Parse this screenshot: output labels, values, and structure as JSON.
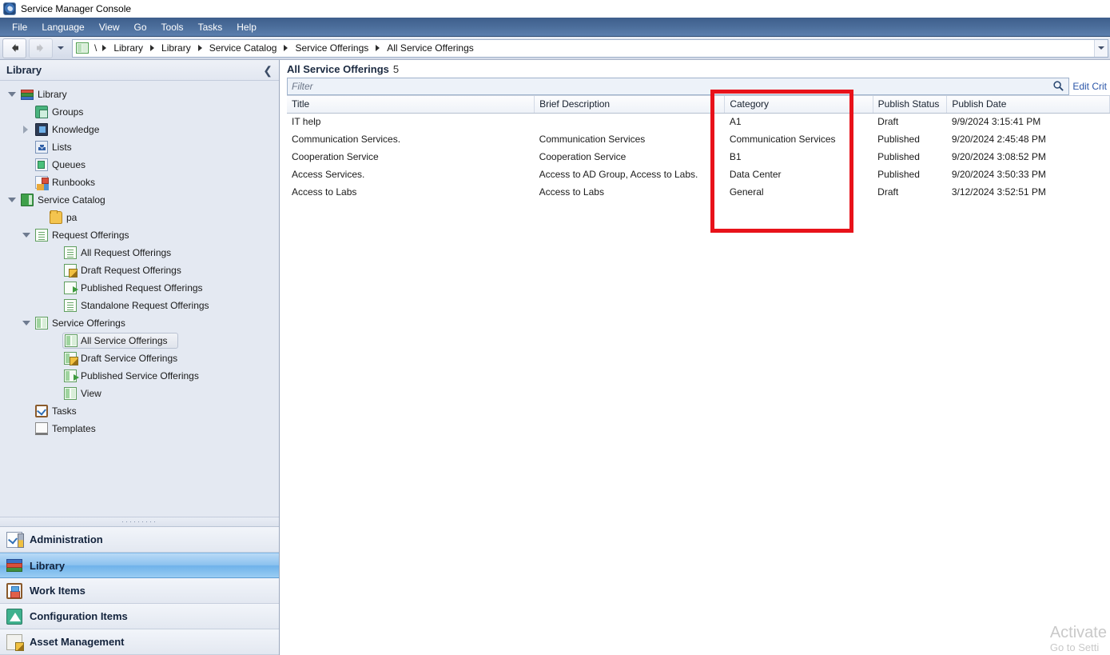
{
  "window": {
    "title": "Service Manager Console",
    "icon": "app-icon"
  },
  "menu": {
    "items": [
      "File",
      "Language",
      "View",
      "Go",
      "Tools",
      "Tasks",
      "Help"
    ]
  },
  "navbar": {
    "back_icon": "back-arrow-icon",
    "forward_icon": "forward-arrow-icon",
    "history_icon": "chevron-down-icon",
    "root_icon": "service-offering-icon",
    "root_separator": "\\",
    "breadcrumbs": [
      "Library",
      "Library",
      "Service Catalog",
      "Service Offerings",
      "All Service Offerings"
    ],
    "dropdown_icon": "chevron-down-icon"
  },
  "sidebar": {
    "header": {
      "title": "Library",
      "collapse_icon": "chevron-left-icon"
    },
    "tree": [
      {
        "label": "Library",
        "indent": 0,
        "twist": "expanded",
        "icon": "books-icon",
        "selected": false
      },
      {
        "label": "Groups",
        "indent": 1,
        "twist": "none",
        "icon": "groups-icon",
        "selected": false
      },
      {
        "label": "Knowledge",
        "indent": 1,
        "twist": "collapsed",
        "icon": "knowledge-icon",
        "selected": false
      },
      {
        "label": "Lists",
        "indent": 1,
        "twist": "none",
        "icon": "lists-icon",
        "selected": false
      },
      {
        "label": "Queues",
        "indent": 1,
        "twist": "none",
        "icon": "queues-icon",
        "selected": false
      },
      {
        "label": "Runbooks",
        "indent": 1,
        "twist": "none",
        "icon": "runbooks-icon",
        "selected": false
      },
      {
        "label": "Service Catalog",
        "indent": 0,
        "twist": "expanded",
        "icon": "service-catalog-icon",
        "selected": false
      },
      {
        "label": "pa",
        "indent": 2,
        "twist": "none",
        "icon": "folder-icon",
        "selected": false
      },
      {
        "label": "Request Offerings",
        "indent": 1,
        "twist": "expanded",
        "icon": "document-icon",
        "selected": false
      },
      {
        "label": "All Request Offerings",
        "indent": 3,
        "twist": "none",
        "icon": "document-icon",
        "selected": false
      },
      {
        "label": "Draft Request Offerings",
        "indent": 3,
        "twist": "none",
        "icon": "document-draft-icon",
        "selected": false
      },
      {
        "label": "Published Request Offerings",
        "indent": 3,
        "twist": "none",
        "icon": "document-published-icon",
        "selected": false
      },
      {
        "label": "Standalone Request Offerings",
        "indent": 3,
        "twist": "none",
        "icon": "document-icon",
        "selected": false
      },
      {
        "label": "Service Offerings",
        "indent": 1,
        "twist": "expanded",
        "icon": "service-offering-icon",
        "selected": false
      },
      {
        "label": "All Service Offerings",
        "indent": 3,
        "twist": "none",
        "icon": "service-offering-icon",
        "selected": true
      },
      {
        "label": "Draft Service Offerings",
        "indent": 3,
        "twist": "none",
        "icon": "service-offering-draft-icon",
        "selected": false
      },
      {
        "label": "Published Service Offerings",
        "indent": 3,
        "twist": "none",
        "icon": "service-offering-published-icon",
        "selected": false
      },
      {
        "label": "View",
        "indent": 3,
        "twist": "none",
        "icon": "service-offering-icon",
        "selected": false
      },
      {
        "label": "Tasks",
        "indent": 1,
        "twist": "none",
        "icon": "tasks-icon",
        "selected": false
      },
      {
        "label": "Templates",
        "indent": 1,
        "twist": "none",
        "icon": "templates-icon",
        "selected": false
      }
    ],
    "splitter_dots": "·········",
    "wunderbar": [
      {
        "label": "Administration",
        "icon": "administration-icon",
        "active": false
      },
      {
        "label": "Library",
        "icon": "library-icon",
        "active": true
      },
      {
        "label": "Work Items",
        "icon": "work-items-icon",
        "active": false
      },
      {
        "label": "Configuration Items",
        "icon": "configuration-items-icon",
        "active": false
      },
      {
        "label": "Asset Management",
        "icon": "asset-management-icon",
        "active": false
      }
    ]
  },
  "main": {
    "view_title": "All Service Offerings",
    "view_count": "5",
    "filter": {
      "placeholder": "Filter",
      "value": "",
      "search_icon": "search-icon"
    },
    "edit_criteria_label": "Edit Crit",
    "columns": [
      "Title",
      "Brief Description",
      "Category",
      "Publish Status",
      "Publish Date"
    ],
    "rows": [
      {
        "Title": "IT help",
        "Brief Description": "",
        "Category": "A1",
        "Publish Status": "Draft",
        "Publish Date": "9/9/2024 3:15:41 PM"
      },
      {
        "Title": "Communication Services.",
        "Brief Description": "Communication Services",
        "Category": "Communication Services",
        "Publish Status": "Published",
        "Publish Date": "9/20/2024 2:45:48 PM"
      },
      {
        "Title": "Cooperation Service",
        "Brief Description": "Cooperation Service",
        "Category": "B1",
        "Publish Status": "Published",
        "Publish Date": "9/20/2024 3:08:52 PM"
      },
      {
        "Title": "Access Services.",
        "Brief Description": "Access to AD Group, Access to Labs.",
        "Category": "Data Center",
        "Publish Status": "Published",
        "Publish Date": "9/20/2024 3:50:33 PM"
      },
      {
        "Title": "Access to Labs",
        "Brief Description": "Access to Labs",
        "Category": "General",
        "Publish Status": "Draft",
        "Publish Date": "3/12/2024 3:52:51 PM"
      }
    ],
    "highlight": {
      "color": "#e8121a",
      "target_column": "Category"
    }
  },
  "watermark": {
    "line1": "Activate",
    "line2": "Go to Setti"
  }
}
